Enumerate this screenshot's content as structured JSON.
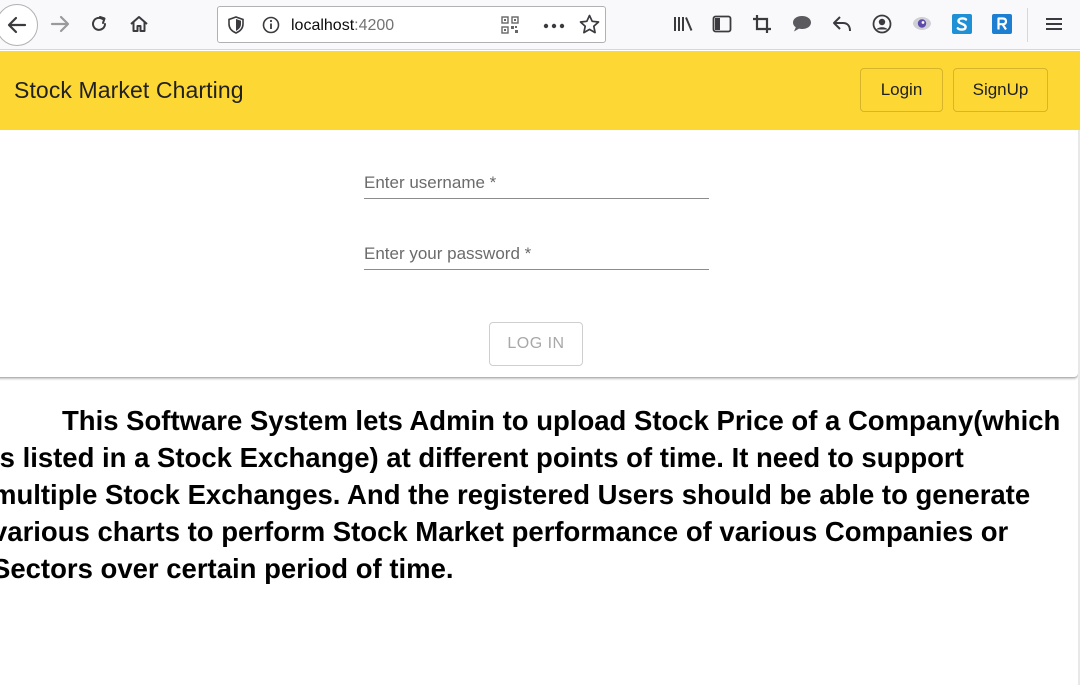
{
  "browser": {
    "url_host": "localhost",
    "url_port": ":4200"
  },
  "icons": {
    "back": "back-arrow-icon",
    "forward": "forward-arrow-icon",
    "reload": "reload-icon",
    "home": "home-icon",
    "tracking_protection": "shield-icon",
    "site_info": "info-icon",
    "qr": "qr-code-icon",
    "page_actions": "more-horizontal-icon",
    "bookmark": "star-icon",
    "library": "library-icon",
    "sidebar": "sidebar-icon",
    "screenshot": "crop-icon",
    "chat": "speech-bubble-icon",
    "undo": "undo-arrow-icon",
    "account": "account-circle-icon",
    "extension": "extension-eye-icon",
    "s_extension": "s-extension-icon",
    "r_extension": "r-extension-icon",
    "menu": "hamburger-menu-icon"
  },
  "app": {
    "title": "Stock Market Charting",
    "header_color": "#fdd835",
    "nav": {
      "login": "Login",
      "signup": "SignUp"
    },
    "form": {
      "username_placeholder": "Enter username *",
      "password_placeholder": "Enter your password *",
      "submit": "LOG IN"
    },
    "description": "This Software System lets Admin to upload Stock Price of a Company(which is listed in a Stock Exchange) at different points of time. It need to support multiple Stock Exchanges. And the registered Users should be able to generate various charts to perform Stock Market performance of various Companies or Sectors over certain period of time."
  }
}
